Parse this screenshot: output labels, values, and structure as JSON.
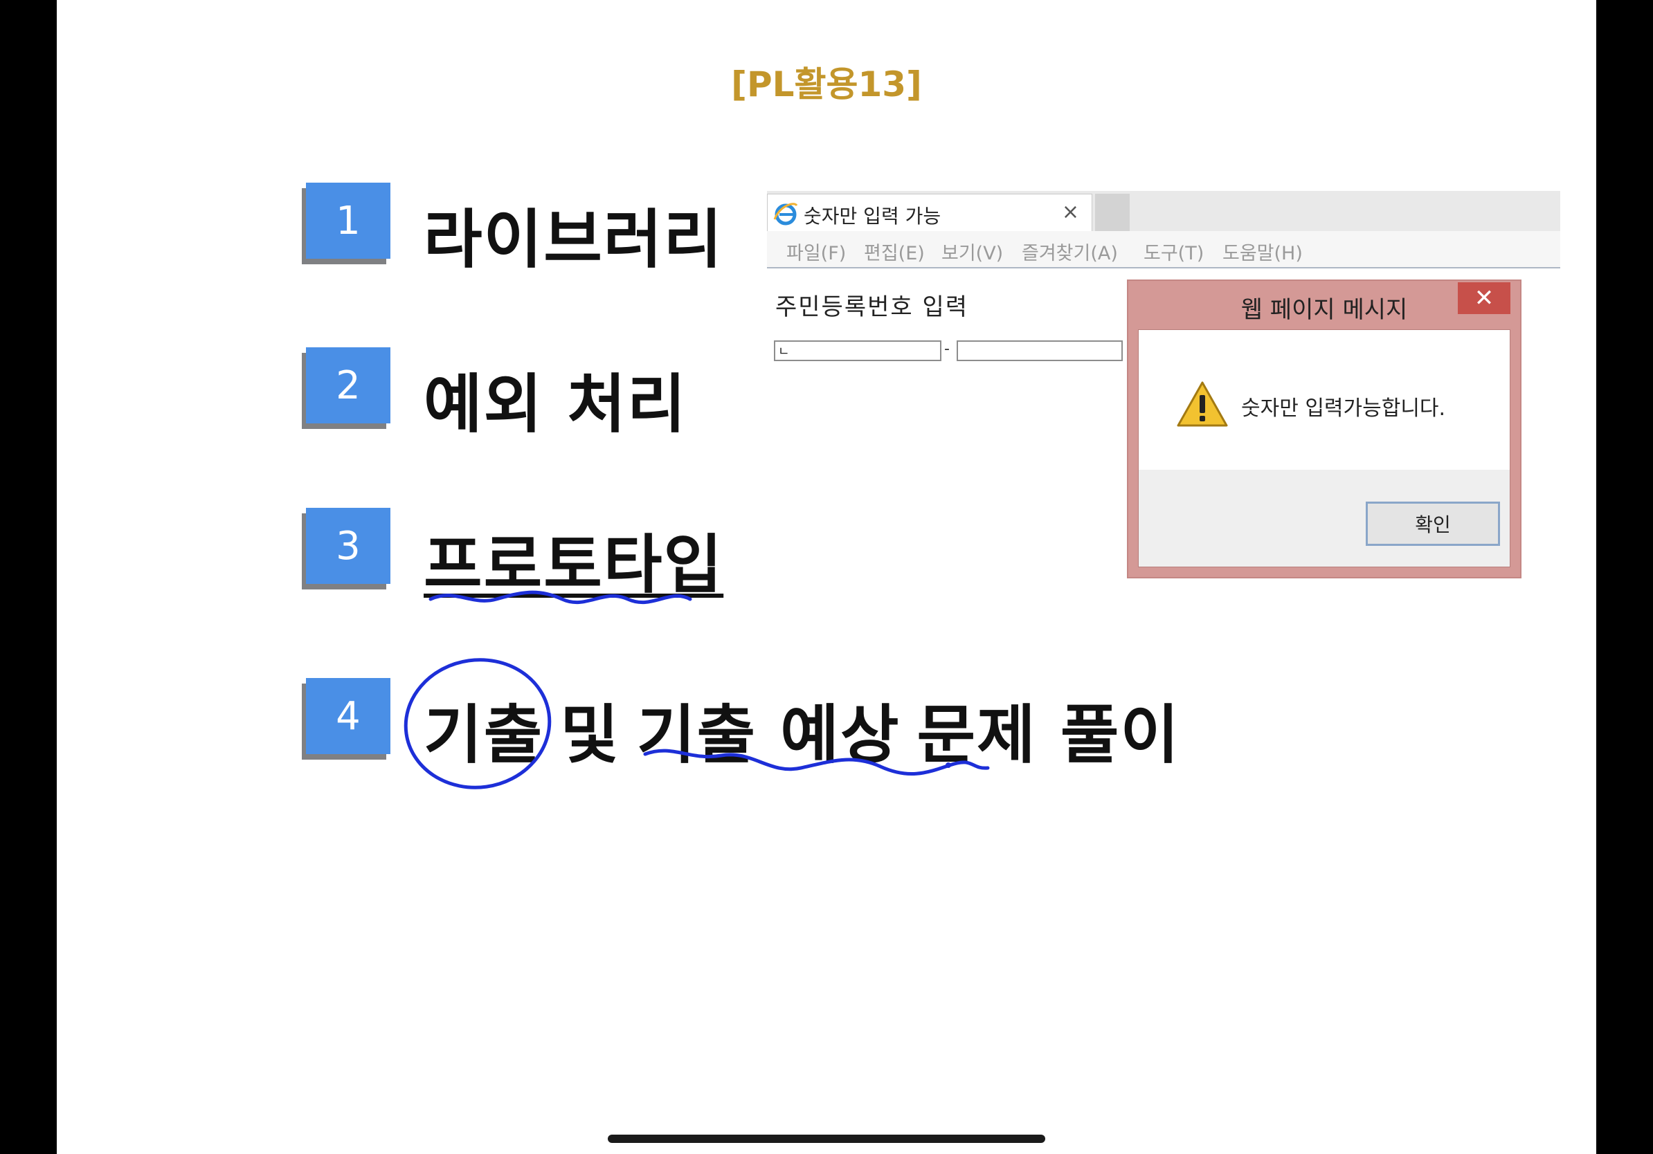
{
  "slide": {
    "title": "[PL활용13]",
    "items": [
      {
        "number": "1",
        "label": "라이브러리"
      },
      {
        "number": "2",
        "label": "예외 처리"
      },
      {
        "number": "3",
        "label": "프로토타입"
      },
      {
        "number": "4",
        "label_parts": [
          "기출",
          "및",
          "기출 예상",
          "문제 풀이"
        ]
      }
    ]
  },
  "browser": {
    "tab_title": "숫자만 입력 가능",
    "tab_close": "×",
    "menu": [
      "파일(F)",
      "편집(E)",
      "보기(V)",
      "즐겨찾기(A)",
      "도구(T)",
      "도움말(H)"
    ],
    "page_heading": "주민등록번호 입력",
    "ssn_first_value": "ㄴ",
    "ssn_dash": "-",
    "ssn_second_value": ""
  },
  "dialog": {
    "title": "웹 페이지 메시지",
    "close": "✕",
    "message": "숫자만 입력가능합니다.",
    "ok_label": "확인",
    "icon": "warning-icon"
  },
  "colors": {
    "title_gold": "#c3962b",
    "number_blue": "#4a8fe6",
    "ink_blue": "#1d2fd8",
    "dialog_frame": "#d49996",
    "dialog_close": "#c7504a"
  }
}
